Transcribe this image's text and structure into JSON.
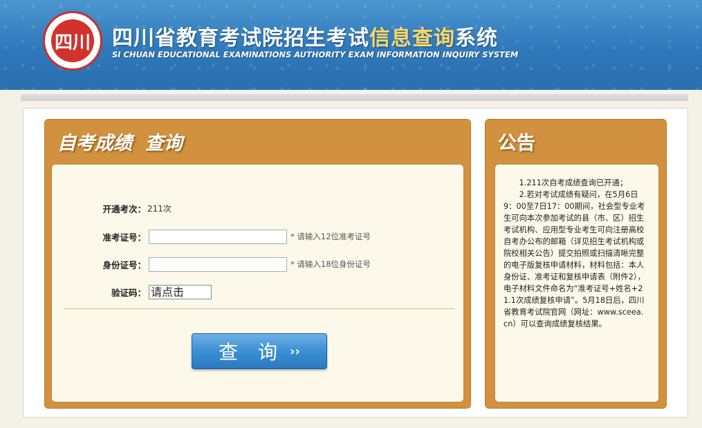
{
  "header": {
    "logo_text": "四川",
    "title_main": "四川省教育考试院招生考试",
    "title_highlight": "信息查询",
    "title_end": "系统",
    "subtitle": "SI CHUAN EDUCATIONAL EXAMINATIONS AUTHORITY EXAM INFORMATION INQUIRY SYSTEM"
  },
  "query_panel": {
    "title": "自考成绩  查询",
    "exam_label": "开通考次：",
    "exam_value": "211次",
    "ticket_label": "准考证号：",
    "ticket_value": "",
    "ticket_hint": "* 请输入12位准考证号",
    "id_label": "身份证号：",
    "id_value": "",
    "id_hint": "* 请输入18位身份证号",
    "captcha_label": "验证码：",
    "captcha_value": "请点击",
    "button_label": "查 询",
    "button_arrow": "››"
  },
  "notice_panel": {
    "title": "公告",
    "paragraphs": [
      "1.211次自考成绩查询已开通；",
      "2.若对考试成绩有疑问，在5月6日9：00至7日17：00期间，社会型专业考生可向本次参加考试的县（市、区）招生考试机构、应用型专业考生可向注册高校自考办公布的邮箱（详见招生考试机构或院校相关公告）提交拍照或扫描清晰完整的电子版复核申请材料，材料包括：本人身份证、准考证和复核申请表（附件2），电子材料文件命名为“准考证号+姓名+21.1次成绩复核申请”。5月18日后，四川省教育考试院官网（网址：www.sceea.cn）可以查询成绩复核结果。"
    ]
  },
  "colors": {
    "header_blue": "#2f78ba",
    "panel_orange": "#d1913e",
    "panel_body": "#fdf9ea",
    "button_blue": "#3b8fd4",
    "highlight_yellow": "#ffd86a"
  }
}
